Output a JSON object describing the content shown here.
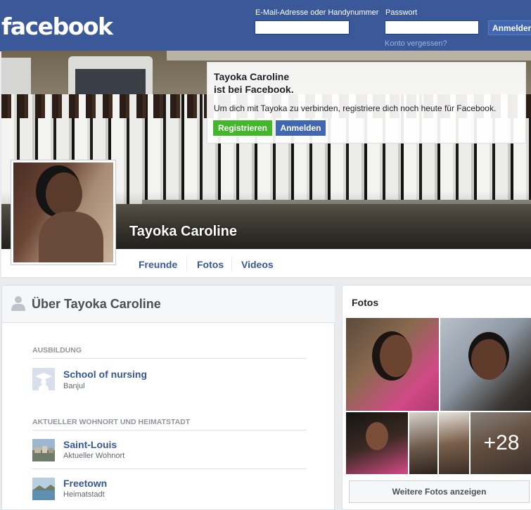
{
  "header": {
    "logo": "facebook",
    "email_label": "E-Mail-Adresse oder Handynummer",
    "password_label": "Passwort",
    "login_button": "Anmelden",
    "forgot_link": "Konto vergessen?"
  },
  "cover": {
    "profile_name": "Tayoka Caroline"
  },
  "join_box": {
    "title_line1": "Tayoka Caroline",
    "title_line2": "ist bei Facebook.",
    "text": "Um dich mit Tayoka zu verbinden, registriere dich noch heute für Facebook.",
    "register_button": "Registrieren",
    "login_button": "Anmelden"
  },
  "nav": {
    "tabs": [
      {
        "label": "Freunde"
      },
      {
        "label": "Fotos"
      },
      {
        "label": "Videos"
      }
    ]
  },
  "about": {
    "title": "Über Tayoka Caroline",
    "education_heading": "AUSBILDUNG",
    "education": [
      {
        "title": "School of nursing",
        "subtitle": "Banjul"
      }
    ],
    "places_heading": "AKTUELLER WOHNORT UND HEIMATSTADT",
    "places": [
      {
        "title": "Saint-Louis",
        "subtitle": "Aktueller Wohnort"
      },
      {
        "title": "Freetown",
        "subtitle": "Heimatstadt"
      }
    ]
  },
  "photos": {
    "title": "Fotos",
    "more_count": "+28",
    "more_button": "Weitere Fotos anzeigen"
  },
  "icons": {
    "user": "user-silhouette-icon",
    "school": "school-placeholder-icon",
    "place": "place-photo-thumbnail"
  },
  "colors": {
    "brand": "#3b5998",
    "link": "#365899",
    "register_green": "#42b72a",
    "button_blue": "#4267b2"
  }
}
